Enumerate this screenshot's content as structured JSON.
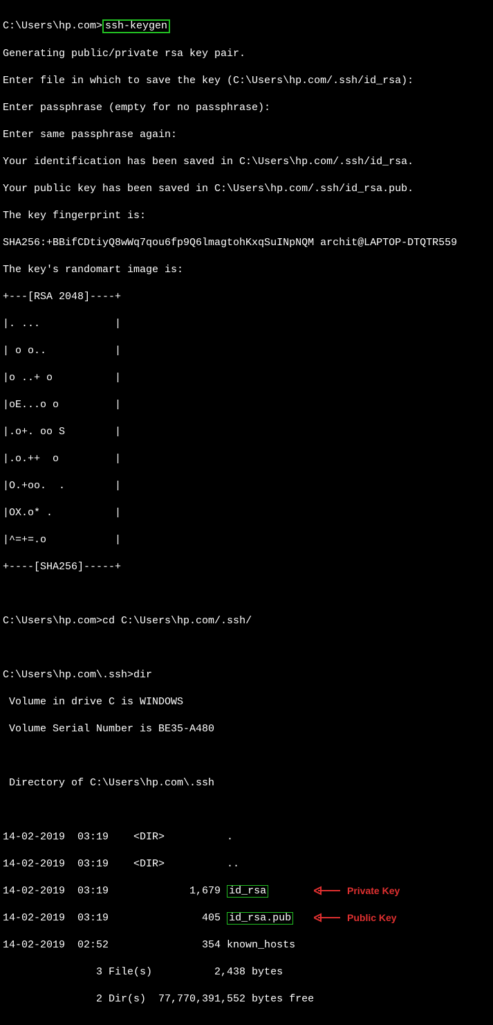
{
  "prompt1": "C:\\Users\\hp.com>",
  "cmd1": "ssh-keygen",
  "out": {
    "l1": "Generating public/private rsa key pair.",
    "l2": "Enter file in which to save the key (C:\\Users\\hp.com/.ssh/id_rsa):",
    "l3": "Enter passphrase (empty for no passphrase):",
    "l4": "Enter same passphrase again:",
    "l5": "Your identification has been saved in C:\\Users\\hp.com/.ssh/id_rsa.",
    "l6": "Your public key has been saved in C:\\Users\\hp.com/.ssh/id_rsa.pub.",
    "l7": "The key fingerprint is:",
    "l8": "SHA256:+BBifCDtiyQ8wWq7qou6fp9Q6lmagtohKxqSuINpNQM archit@LAPTOP-DTQTR559",
    "l9": "The key's randomart image is:"
  },
  "art": {
    "a1": "+---[RSA 2048]----+",
    "a2": "|. ...            |",
    "a3": "| o o..           |",
    "a4": "|o ..+ o          |",
    "a5": "|oE...o o         |",
    "a6": "|.o+. oo S        |",
    "a7": "|.o.++  o         |",
    "a8": "|O.+oo.  .        |",
    "a9": "|OX.o* .          |",
    "a10": "|^=+=.o           |",
    "a11": "+----[SHA256]-----+"
  },
  "prompt2": "C:\\Users\\hp.com>",
  "cmd2": "cd C:\\Users\\hp.com/.ssh/",
  "prompt3": "C:\\Users\\hp.com\\.ssh>",
  "cmd3": "dir",
  "dir": {
    "d1": " Volume in drive C is WINDOWS",
    "d2": " Volume Serial Number is BE35-A480",
    "d3": " Directory of C:\\Users\\hp.com\\.ssh",
    "r1": "14-02-2019  03:19    <DIR>          .",
    "r2": "14-02-2019  03:19    <DIR>          ..",
    "r3a": "14-02-2019  03:19             1,679 ",
    "r3b": "id_rsa",
    "r4a": "14-02-2019  03:19               405 ",
    "r4b": "id_rsa.pub",
    "r5": "14-02-2019  02:52               354 known_hosts",
    "s1": "               3 File(s)          2,438 bytes",
    "s2": "               2 Dir(s)  77,770,391,552 bytes free"
  },
  "labels": {
    "private": "Private Key",
    "public": "Public Key"
  }
}
